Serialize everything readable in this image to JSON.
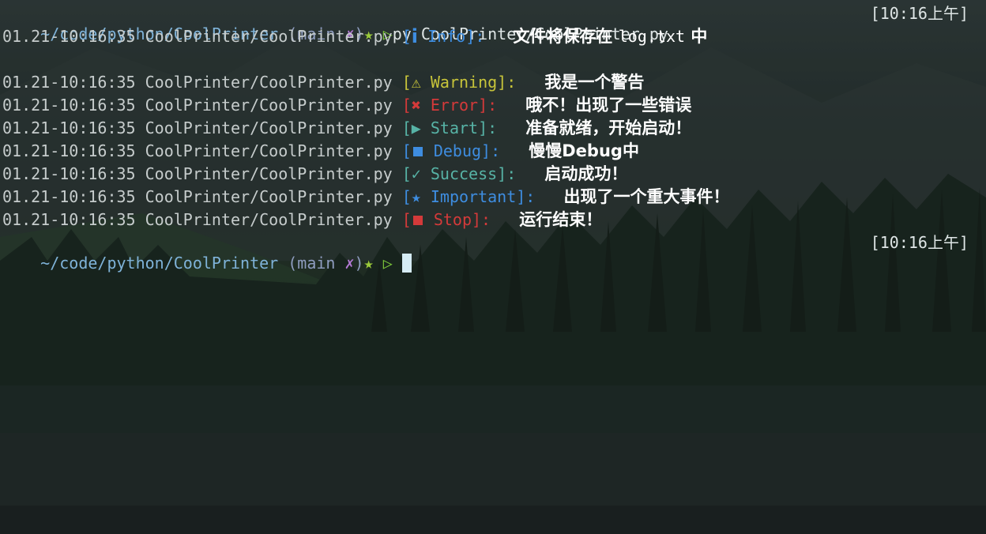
{
  "prompt": {
    "cwd": "~/code/python/CoolPrinter",
    "branch_open": " (main ",
    "dirty": "✗",
    "branch_close": ")",
    "star": "★",
    "arrow": "▷",
    "command": "py CoolPrinter/CoolPrinter.py",
    "clock": "[10:16上午]"
  },
  "info_line": {
    "timestamp": "01.21-10:16:35",
    "file": "CoolPrinter/CoolPrinter.py",
    "tag_open": "[",
    "icon": "i",
    "tag_label": " Info]:",
    "message_pre": "文件将保存在 ",
    "message_file": "log.txt",
    "message_post": " 中"
  },
  "log_lines": [
    {
      "timestamp": "01.21-10:16:35",
      "file": "CoolPrinter/CoolPrinter.py",
      "level": "warning",
      "icon_name": "warning-icon",
      "icon": "⚠",
      "tag_open": "[",
      "tag_label": " Warning]:",
      "message": "我是一个警告"
    },
    {
      "timestamp": "01.21-10:16:35",
      "file": "CoolPrinter/CoolPrinter.py",
      "level": "error",
      "icon_name": "cross-icon",
      "icon": "✖",
      "tag_open": "[",
      "tag_label": " Error]:",
      "message": "哦不！出现了一些错误"
    },
    {
      "timestamp": "01.21-10:16:35",
      "file": "CoolPrinter/CoolPrinter.py",
      "level": "start",
      "icon_name": "play-icon",
      "icon": "▶",
      "tag_open": "[",
      "tag_label": " Start]:",
      "message": "准备就绪，开始启动！"
    },
    {
      "timestamp": "01.21-10:16:35",
      "file": "CoolPrinter/CoolPrinter.py",
      "level": "debug",
      "icon_name": "square-icon",
      "icon": "■",
      "tag_open": "[",
      "tag_label": " Debug]:",
      "message": "慢慢Debug中"
    },
    {
      "timestamp": "01.21-10:16:35",
      "file": "CoolPrinter/CoolPrinter.py",
      "level": "success",
      "icon_name": "check-icon",
      "icon": "✓",
      "tag_open": "[",
      "tag_label": " Success]:",
      "message": "启动成功！"
    },
    {
      "timestamp": "01.21-10:16:35",
      "file": "CoolPrinter/CoolPrinter.py",
      "level": "important",
      "icon_name": "star-icon",
      "icon": "★",
      "tag_open": "[",
      "tag_label": " Important]:",
      "message": "出现了一个重大事件！"
    },
    {
      "timestamp": "01.21-10:16:35",
      "file": "CoolPrinter/CoolPrinter.py",
      "level": "stop",
      "icon_name": "stop-square-icon",
      "icon": "■",
      "tag_open": "[",
      "tag_label": " Stop]:",
      "message": "运行结束！"
    }
  ],
  "prompt2": {
    "cwd": "~/code/python/CoolPrinter",
    "branch_open": " (main ",
    "dirty": "✗",
    "branch_close": ")",
    "star": "★",
    "arrow": "▷",
    "clock": "[10:16上午]"
  },
  "colors": {
    "info": "#3e8de0",
    "warning": "#c7c43a",
    "error": "#d43a3a",
    "start": "#57b3a6",
    "success": "#57b3a6",
    "stop": "#d43a3a"
  }
}
